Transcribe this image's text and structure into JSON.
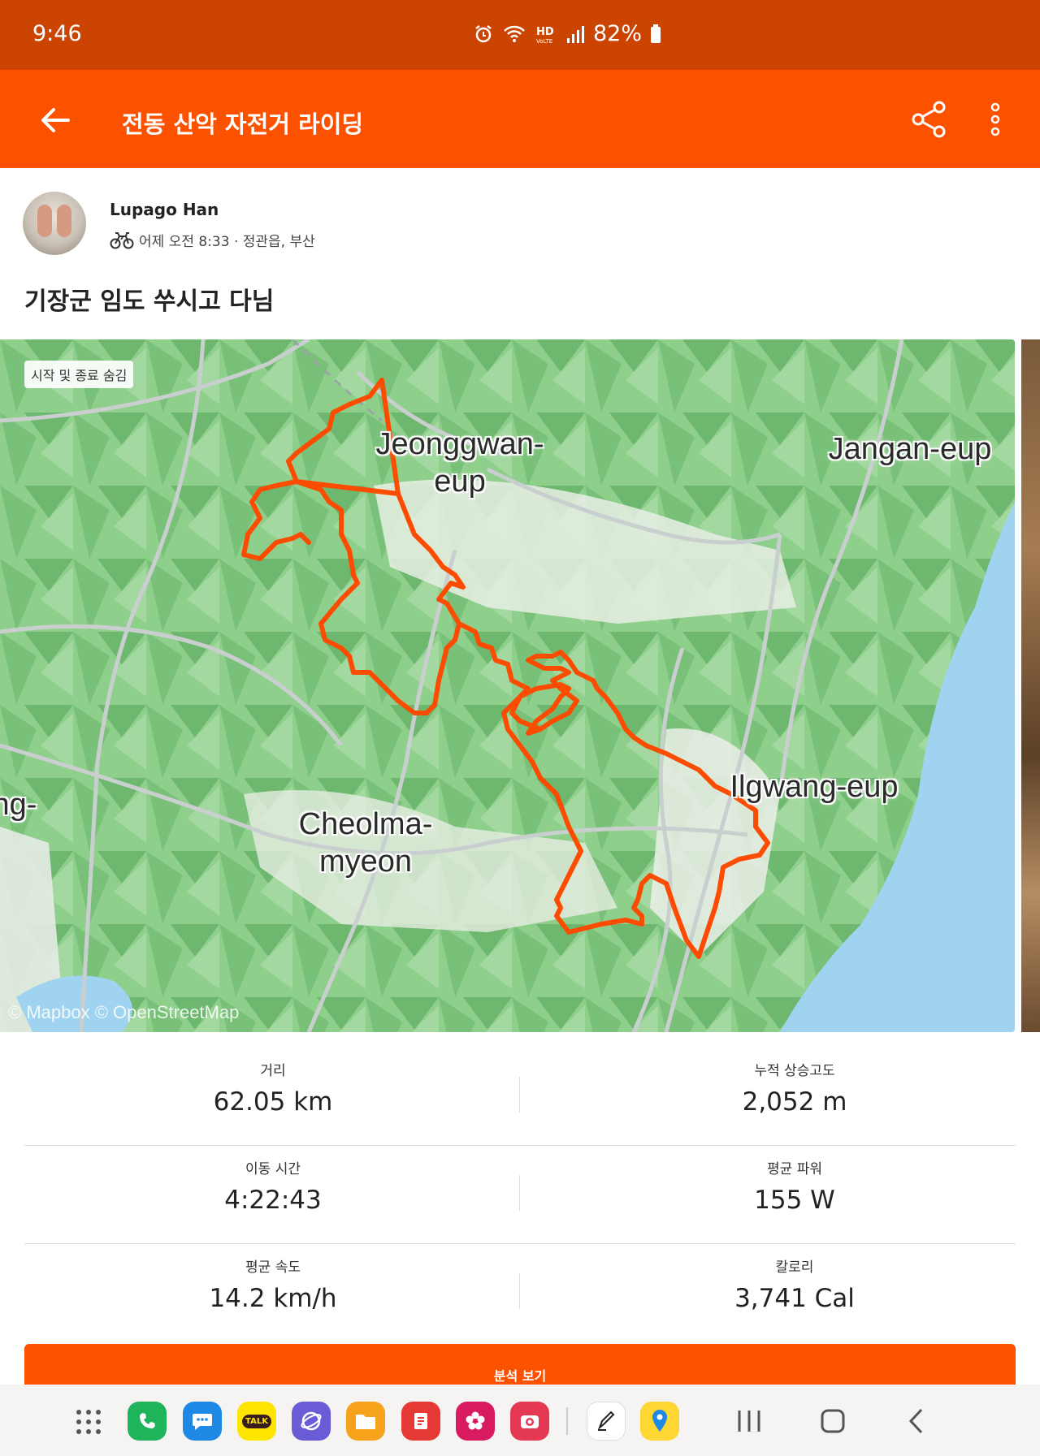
{
  "status_bar": {
    "time": "9:46",
    "battery": "82%",
    "icons": [
      "alarm-icon",
      "wifi-icon",
      "hd-voice-icon",
      "signal-icon",
      "battery-icon"
    ]
  },
  "app_bar": {
    "title": "전동 산악 자전거 라이딩"
  },
  "author": {
    "name": "Lupago Han",
    "meta": "어제 오전 8:33 · 정관읍, 부산"
  },
  "activity_title": "기장군 임도 쑤시고 다님",
  "map": {
    "hide_toggle": "시작 및 종료 숨김",
    "places": [
      "Jeonggwan-\neup",
      "Jangan-eup",
      "Ilgwang-eup",
      "Cheolma-\nmyeon",
      "ng-"
    ],
    "attribution": "© Mapbox © OpenStreetMap",
    "route_color": "#fc4c02"
  },
  "stats": [
    {
      "label": "거리",
      "value": "62.05 km"
    },
    {
      "label": "누적 상승고도",
      "value": "2,052 m"
    },
    {
      "label": "이동 시간",
      "value": "4:22:43"
    },
    {
      "label": "평균 파워",
      "value": "155 W"
    },
    {
      "label": "평균 속도",
      "value": "14.2 km/h"
    },
    {
      "label": "칼로리",
      "value": "3,741 Cal"
    }
  ],
  "analysis_button": "분석 보기",
  "colors": {
    "brand": "#fc5200",
    "status_bar": "#cc4402"
  },
  "nav_apps": [
    "apps-grid-icon",
    "phone-icon",
    "messages-icon",
    "kakaotalk-icon",
    "internet-icon",
    "files-icon",
    "notes-icon",
    "gallery-icon",
    "camera-icon",
    "pen-icon",
    "maps-icon"
  ],
  "nav_apps_labels": {
    "kakao": "TALK"
  }
}
